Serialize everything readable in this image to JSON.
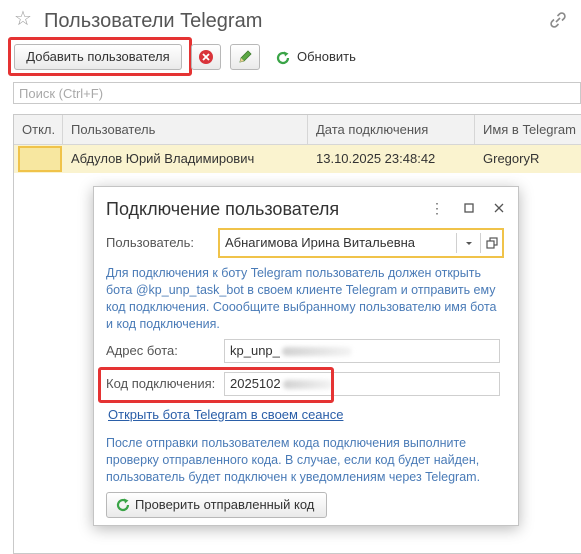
{
  "header": {
    "title": "Пользователи Telegram"
  },
  "toolbar": {
    "add_label": "Добавить пользователя",
    "refresh_label": "Обновить"
  },
  "search": {
    "placeholder": "Поиск (Ctrl+F)",
    "value": ""
  },
  "table": {
    "columns": [
      "Откл.",
      "Пользователь",
      "Дата подключения",
      "Имя в Telegram"
    ],
    "rows": [
      {
        "disabled": "",
        "user": "Абдулов Юрий Владимирович",
        "date": "13.10.2025 23:48:42",
        "tg_name": "GregoryR"
      }
    ]
  },
  "dialog": {
    "title": "Подключение пользователя",
    "user_label": "Пользователь:",
    "user_value": "Абнагимова Ирина Витальевна",
    "info_text": "Для подключения к боту Telegram пользователь должен открыть бота @kp_unp_task_bot в своем клиенте Telegram и отправить ему код подключения. Соообщите выбранному пользователю имя бота и код подключения.",
    "bot_address_label": "Адрес бота:",
    "bot_address_value": "kp_unp_",
    "code_label": "Код подключения:",
    "code_value": "2025102",
    "open_link": "Открыть бота Telegram в своем сеансе",
    "after_text": "После отправки пользователем кода подключения выполните проверку отправленного кода. В случае, если код будет найден, пользователь будет подключен к уведомлениям через Telegram.",
    "check_button": "Проверить отправленный код"
  },
  "colors": {
    "highlight_red": "#e53333",
    "row_selected": "#faf3cf",
    "info_blue": "#4a7bb7",
    "refresh_green": "#3aa447"
  }
}
